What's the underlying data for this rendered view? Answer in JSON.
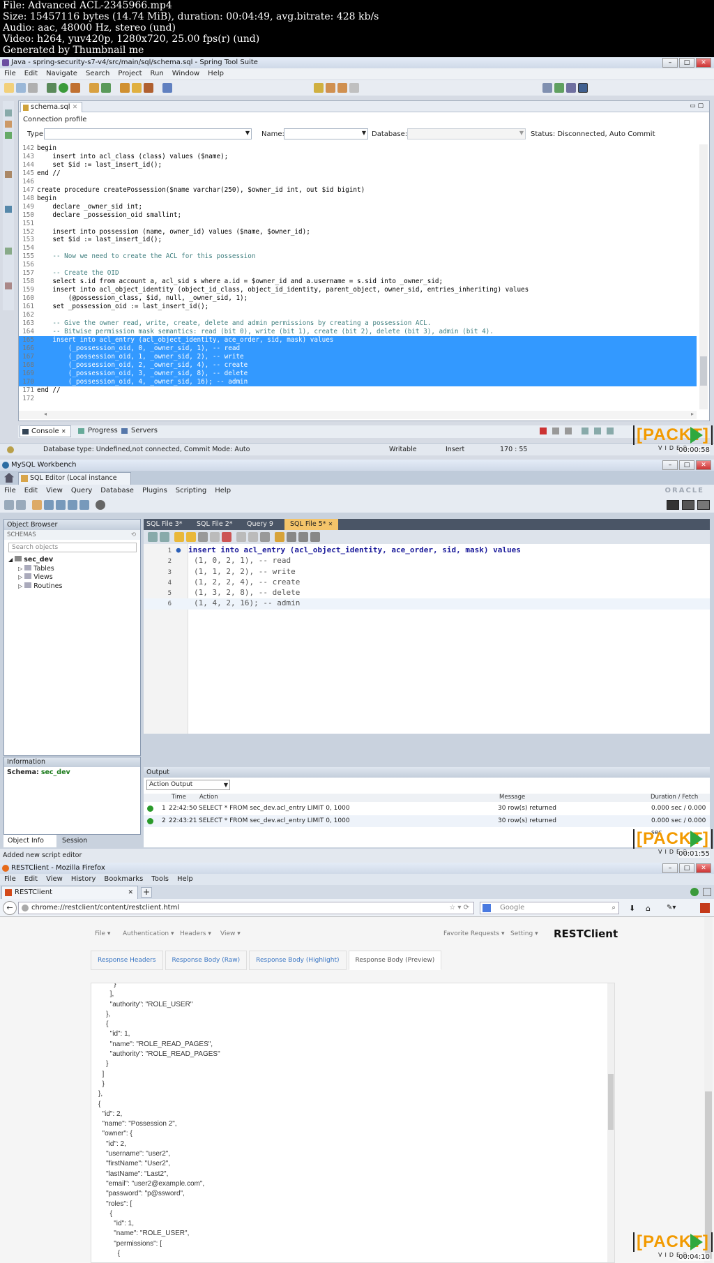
{
  "header": {
    "lines": [
      "File: Advanced ACL-2345966.mp4",
      "Size: 15457116 bytes (14.74 MiB), duration: 00:04:49, avg.bitrate: 428 kb/s",
      "Audio: aac, 48000 Hz, stereo (und)",
      "Video: h264, yuv420p, 1280x720, 25.00 fps(r) (und)",
      "Generated by Thumbnail me"
    ]
  },
  "sts": {
    "title": "Java - spring-security-s7-v4/src/main/sql/schema.sql - Spring Tool Suite",
    "menu": [
      "File",
      "Edit",
      "Navigate",
      "Search",
      "Project",
      "Run",
      "Window",
      "Help"
    ],
    "editor_tab": "schema.sql",
    "connection_profile": "Connection profile",
    "type_label": "Type:",
    "name_label": "Name:",
    "database_label": "Database:",
    "status_label": "Status: Disconnected, Auto Commit",
    "bottom_tabs": [
      "Console",
      "Progress",
      "Servers"
    ],
    "statusbar": {
      "db": "Database type: Undefined,not connected, Commit Mode: Auto",
      "writable": "Writable",
      "insert": "Insert",
      "position": "170 : 55"
    },
    "timestamp": "00:00:58",
    "code": [
      {
        "n": "142",
        "t": "begin",
        "s": false
      },
      {
        "n": "143",
        "t": "    insert into acl_class (class) values ($name);",
        "s": false
      },
      {
        "n": "144",
        "t": "    set $id := last_insert_id();",
        "s": false
      },
      {
        "n": "145",
        "t": "end //",
        "s": false
      },
      {
        "n": "146",
        "t": "",
        "s": false
      },
      {
        "n": "147",
        "t": "create procedure createPossession($name varchar(250), $owner_id int, out $id bigint)",
        "s": false
      },
      {
        "n": "148",
        "t": "begin",
        "s": false
      },
      {
        "n": "149",
        "t": "    declare _owner_sid int;",
        "s": false
      },
      {
        "n": "150",
        "t": "    declare _possession_oid smallint;",
        "s": false
      },
      {
        "n": "151",
        "t": "",
        "s": false
      },
      {
        "n": "152",
        "t": "    insert into possession (name, owner_id) values ($name, $owner_id);",
        "s": false
      },
      {
        "n": "153",
        "t": "    set $id := last_insert_id();",
        "s": false
      },
      {
        "n": "154",
        "t": "",
        "s": false
      },
      {
        "n": "155",
        "t": "    -- Now we need to create the ACL for this possession",
        "s": false
      },
      {
        "n": "156",
        "t": "",
        "s": false
      },
      {
        "n": "157",
        "t": "    -- Create the OID",
        "s": false
      },
      {
        "n": "158",
        "t": "    select s.id from account a, acl_sid s where a.id = $owner_id and a.username = s.sid into _owner_sid;",
        "s": false
      },
      {
        "n": "159",
        "t": "    insert into acl_object_identity (object_id_class, object_id_identity, parent_object, owner_sid, entries_inheriting) values",
        "s": false
      },
      {
        "n": "160",
        "t": "        (@possession_class, $id, null, _owner_sid, 1);",
        "s": false
      },
      {
        "n": "161",
        "t": "    set _possession_oid := last_insert_id();",
        "s": false
      },
      {
        "n": "162",
        "t": "",
        "s": false
      },
      {
        "n": "163",
        "t": "    -- Give the owner read, write, create, delete and admin permissions by creating a possession ACL.",
        "s": false
      },
      {
        "n": "164",
        "t": "    -- Bitwise permission mask semantics: read (bit 0), write (bit 1), create (bit 2), delete (bit 3), admin (bit 4).",
        "s": false
      },
      {
        "n": "165",
        "t": "    insert into acl_entry (acl_object_identity, ace_order, sid, mask) values",
        "s": true
      },
      {
        "n": "166",
        "t": "        (_possession_oid, 0, _owner_sid, 1), -- read",
        "s": true
      },
      {
        "n": "167",
        "t": "        (_possession_oid, 1, _owner_sid, 2), -- write",
        "s": true
      },
      {
        "n": "168",
        "t": "        (_possession_oid, 2, _owner_sid, 4), -- create",
        "s": true
      },
      {
        "n": "169",
        "t": "        (_possession_oid, 3, _owner_sid, 8), -- delete",
        "s": true
      },
      {
        "n": "170",
        "t": "        (_possession_oid, 4, _owner_sid, 16); -- admin",
        "s": true
      },
      {
        "n": "171",
        "t": "end //",
        "s": false
      },
      {
        "n": "172",
        "t": "",
        "s": false
      }
    ]
  },
  "wb": {
    "title": "MySQL Workbench",
    "tab": "SQL Editor (Local instance M...",
    "menu": [
      "File",
      "Edit",
      "View",
      "Query",
      "Database",
      "Plugins",
      "Scripting",
      "Help"
    ],
    "oracle": "ORACLE",
    "object_browser": "Object Browser",
    "schemas": "SCHEMAS",
    "search_placeholder": "Search objects",
    "tree": [
      "sec_dev",
      "Tables",
      "Views",
      "Routines"
    ],
    "sql_tabs": [
      "SQL File 3*",
      "SQL File 2*",
      "Query 9",
      "SQL File 5*"
    ],
    "sql": [
      {
        "n": "1",
        "t": "insert into acl_entry (acl_object_identity, ace_order, sid, mask) values"
      },
      {
        "n": "2",
        "t": "(1, 0, 2, 1), -- read"
      },
      {
        "n": "3",
        "t": "(1, 1, 2, 2), -- write"
      },
      {
        "n": "4",
        "t": "(1, 2, 2, 4), -- create"
      },
      {
        "n": "5",
        "t": "(1, 3, 2, 8), -- delete"
      },
      {
        "n": "6",
        "t": "(1, 4, 2, 16); -- admin"
      }
    ],
    "information": "Information",
    "schema_label": "Schema:",
    "schema_value": "sec_dev",
    "info_tabs": [
      "Object Info",
      "Session"
    ],
    "output": "Output",
    "output_select": "Action Output",
    "out_headers": [
      "Time",
      "Action",
      "Message",
      "Duration / Fetch"
    ],
    "out_rows": [
      {
        "n": "1",
        "time": "22:42:50",
        "action": "SELECT * FROM sec_dev.acl_entry LIMIT 0, 1000",
        "msg": "30 row(s) returned",
        "dur": "0.000 sec / 0.000 sec"
      },
      {
        "n": "2",
        "time": "22:43:21",
        "action": "SELECT * FROM sec_dev.acl_entry LIMIT 0, 1000",
        "msg": "30 row(s) returned",
        "dur": "0.000 sec / 0.000 sec"
      }
    ],
    "status": "Added new script editor",
    "timestamp": "00:01:55"
  },
  "ff": {
    "title": "RESTClient - Mozilla Firefox",
    "menu": [
      "File",
      "Edit",
      "View",
      "History",
      "Bookmarks",
      "Tools",
      "Help"
    ],
    "tab": "RESTClient",
    "url": "chrome://restclient/content/restclient.html",
    "search_placeholder": "Google",
    "app_menu": [
      "File",
      "Authentication",
      "Headers",
      "View"
    ],
    "right_menu": [
      "Favorite Requests",
      "Setting"
    ],
    "brand": "RESTClient",
    "tabs": [
      "Response Headers",
      "Response Body (Raw)",
      "Response Body (Highlight)",
      "Response Body (Preview)"
    ],
    "json": "        }\n      ],\n      \"authority\": \"ROLE_USER\"\n    },\n    {\n      \"id\": 1,\n      \"name\": \"ROLE_READ_PAGES\",\n      \"authority\": \"ROLE_READ_PAGES\"\n    }\n  ]\n  }\n},\n{\n  \"id\": 2,\n  \"name\": \"Possession 2\",\n  \"owner\": {\n    \"id\": 2,\n    \"username\": \"user2\",\n    \"firstName\": \"User2\",\n    \"lastName\": \"Last2\",\n    \"email\": \"user2@example.com\",\n    \"password\": \"p@ssword\",\n    \"roles\": [\n      {\n        \"id\": 1,\n        \"name\": \"ROLE_USER\",\n        \"permissions\": [\n          {",
    "timestamp": "00:04:10"
  },
  "packt": {
    "brand": "[PACKT]",
    "video": "VIDEO"
  }
}
